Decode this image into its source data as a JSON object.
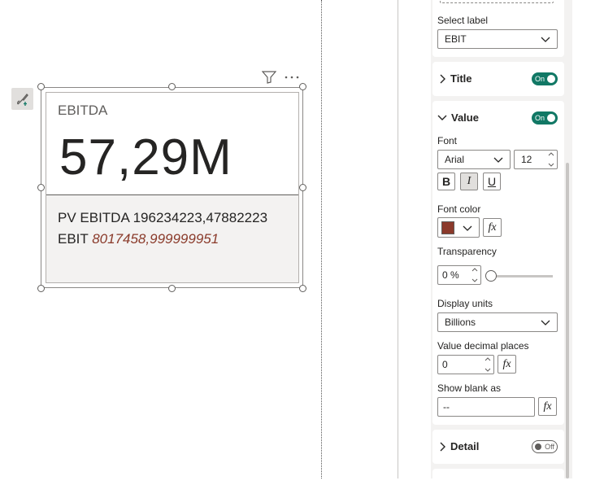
{
  "card": {
    "label": "EBITDA",
    "value": "57,29M",
    "detail_line1": "PV EBITDA 196234223,47882223",
    "detail_line2_prefix": "EBIT ",
    "detail_line2_value": "8017458,999999951"
  },
  "format_pane": {
    "select_label": {
      "label": "Select label",
      "value": "EBIT"
    },
    "title_section": {
      "header": "Title",
      "toggle": "On"
    },
    "value_section": {
      "header": "Value",
      "toggle": "On",
      "font_label": "Font",
      "font_family": "Arial",
      "font_size": "12",
      "bold": "B",
      "italic": "I",
      "underline": "U",
      "font_color_label": "Font color",
      "font_color": "#8b3a2b",
      "transparency_label": "Transparency",
      "transparency_value": "0 %",
      "display_units_label": "Display units",
      "display_units_value": "Billions",
      "decimal_places_label": "Value decimal places",
      "decimal_places_value": "0",
      "show_blank_label": "Show blank as",
      "show_blank_value": "--",
      "fx": "fx"
    },
    "detail_section": {
      "header": "Detail",
      "toggle": "Off"
    }
  },
  "colors": {
    "toggle_on": "#117865",
    "accent_text": "#8a3a2a"
  }
}
